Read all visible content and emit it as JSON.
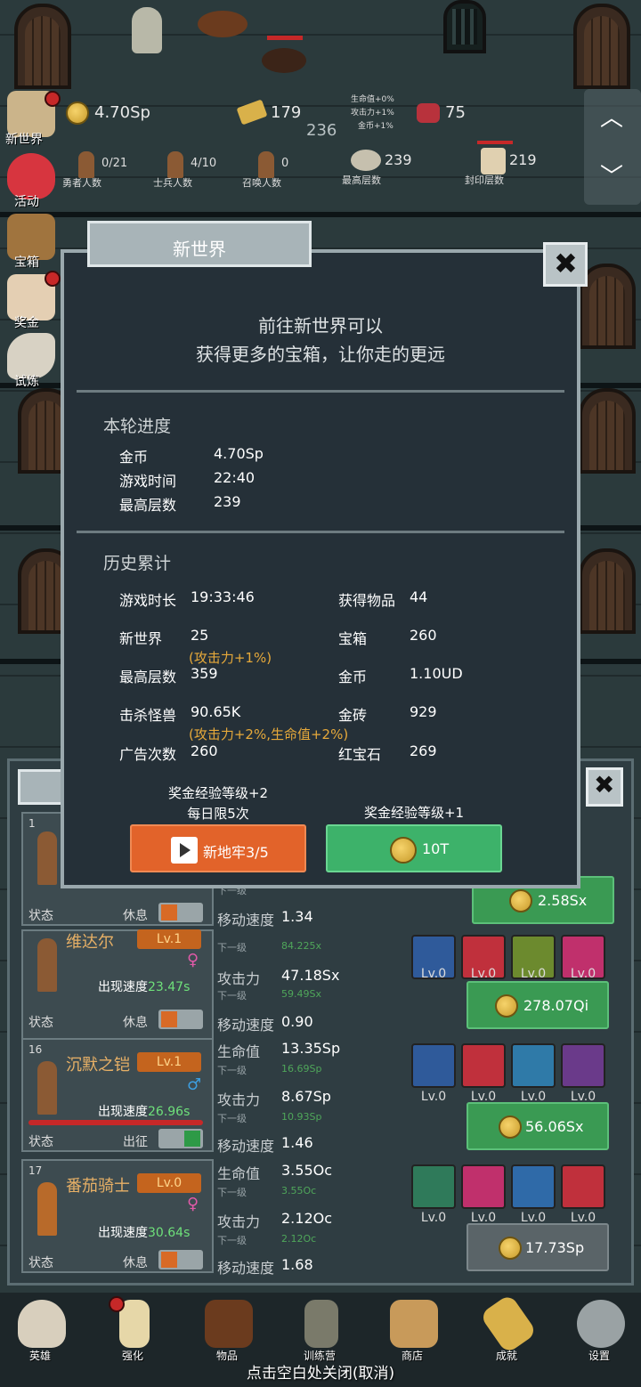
{
  "topbar": {
    "gold": "4.70Sp",
    "gold_bars": "179",
    "floor_current": "236",
    "buffs": [
      "生命值+0%",
      "攻击力+1%",
      "金币+1%"
    ],
    "rubies": "75",
    "heroes_count": "0/21",
    "heroes_label": "勇者人数",
    "soldiers_count": "4/10",
    "soldiers_label": "士兵人数",
    "summons_count": "0",
    "summons_label": "召唤人数",
    "max_floor": "239",
    "max_floor_label": "最高层数",
    "seal_floor": "219",
    "seal_floor_label": "封印层数"
  },
  "sidebar": [
    {
      "label": "新世界"
    },
    {
      "label": "活动"
    },
    {
      "label": "宝箱"
    },
    {
      "label": "奖金"
    },
    {
      "label": "试炼"
    }
  ],
  "dialog": {
    "tab_title": "新世界",
    "intro_line1": "前往新世界可以",
    "intro_line2": "获得更多的宝箱，让你走的更远",
    "round_title": "本轮进度",
    "round": [
      {
        "k": "金币",
        "v": "4.70Sp"
      },
      {
        "k": "游戏时间",
        "v": "22:40"
      },
      {
        "k": "最高层数",
        "v": "239"
      }
    ],
    "history_title": "历史累计",
    "history": {
      "play_time_k": "游戏时长",
      "play_time_v": "19:33:46",
      "items_k": "获得物品",
      "items_v": "44",
      "newworld_k": "新世界",
      "newworld_v": "25",
      "newworld_note": "(攻击力+1%)",
      "chest_k": "宝箱",
      "chest_v": "260",
      "maxfloor_k": "最高层数",
      "maxfloor_v": "359",
      "coin_k": "金币",
      "coin_v": "1.10UD",
      "kills_k": "击杀怪兽",
      "kills_v": "90.65K",
      "bricks_k": "金砖",
      "bricks_v": "929",
      "kills_note": "(攻击力+2%,生命值+2%)",
      "ads_k": "广告次数",
      "ads_v": "260",
      "ruby_k": "红宝石",
      "ruby_v": "269"
    },
    "left_cap1": "奖金经验等级+2",
    "left_cap2": "每日限5次",
    "right_cap": "奖金经验等级+1",
    "left_button": "新地牢3/5",
    "right_button": "10T"
  },
  "heroes": [
    {
      "num": "1",
      "state": "状态",
      "rest": "休息",
      "move_label": "移动速度",
      "move": "1.34",
      "next": "下一级",
      "cost": "2.58Sx"
    },
    {
      "num": "",
      "name": "维达尔",
      "lvl": "Lv.1",
      "speed_label": "出现速度",
      "speed": "23.47s",
      "state": "状态",
      "rest": "休息",
      "hp_next": "84.225x",
      "next": "下一级",
      "atk_label": "攻击力",
      "atk": "47.18Sx",
      "atk_next": "59.49Sx",
      "move_label": "移动速度",
      "move": "0.90",
      "skills": [
        "Lv.0",
        "Lv.0",
        "Lv.0",
        "Lv.0"
      ],
      "cost": "278.07Qi"
    },
    {
      "num": "16",
      "name": "沉默之铠",
      "lvl": "Lv.1",
      "speed_label": "出现速度",
      "speed": "26.96s",
      "state": "状态",
      "rest": "出征",
      "hp_label": "生命值",
      "hp": "13.35Sp",
      "hp_next": "16.69Sp",
      "next": "下一级",
      "atk_label": "攻击力",
      "atk": "8.67Sp",
      "atk_next": "10.93Sp",
      "move_label": "移动速度",
      "move": "1.46",
      "skills": [
        "Lv.0",
        "Lv.0",
        "Lv.0",
        "Lv.0"
      ],
      "cost": "56.06Sx"
    },
    {
      "num": "17",
      "name": "番茄骑士",
      "lvl": "Lv.0",
      "speed_label": "出现速度",
      "speed": "30.64s",
      "state": "状态",
      "rest": "休息",
      "hp_label": "生命值",
      "hp": "3.55Oc",
      "hp_next": "3.55Oc",
      "next": "下一级",
      "atk_label": "攻击力",
      "atk": "2.12Oc",
      "atk_next": "2.12Oc",
      "move_label": "移动速度",
      "move": "1.68",
      "skills": [
        "Lv.0",
        "Lv.0",
        "Lv.0",
        "Lv.0"
      ],
      "cost": "17.73Sp"
    }
  ],
  "nav": [
    {
      "label": "英雄"
    },
    {
      "label": "强化"
    },
    {
      "label": "物品"
    },
    {
      "label": "训练营"
    },
    {
      "label": "商店"
    },
    {
      "label": "成就"
    },
    {
      "label": "设置"
    }
  ],
  "hint": "点击空白处关闭(取消)",
  "arrows": {
    "up": "︿",
    "down": "﹀"
  },
  "close_icon": "✖",
  "colors": {
    "orange_button": "#e2632a",
    "green_button": "#3db26a",
    "note_gold": "#e6a93a",
    "speed_green": "#6ee07a"
  }
}
